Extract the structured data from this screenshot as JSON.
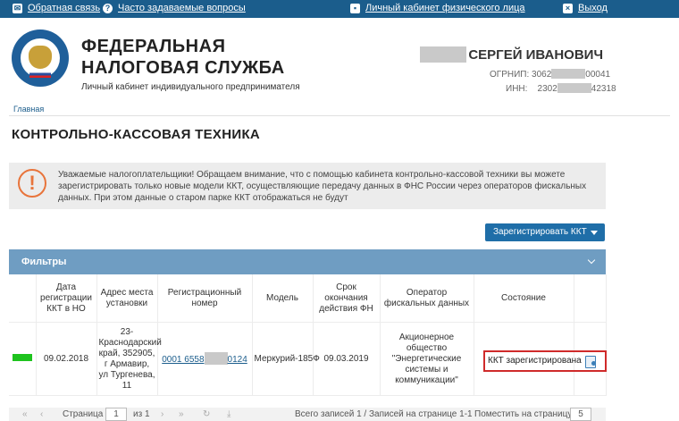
{
  "topbar": {
    "feedback": "Обратная связь",
    "faq": "Часто задаваемые вопросы",
    "personal_account": "Личный кабинет физического лица",
    "exit": "Выход"
  },
  "header": {
    "org_title_line1": "ФЕДЕРАЛЬНАЯ",
    "org_title_line2": "НАЛОГОВАЯ СЛУЖБА",
    "org_subtitle": "Личный кабинет индивидуального предпринимателя",
    "user_name": "СЕРГЕЙ ИВАНОВИЧ",
    "ogrnip_label": "ОГРНИП:",
    "ogrnip_prefix": "3062",
    "ogrnip_suffix": "00041",
    "inn_label": "ИНН:",
    "inn_prefix": "2302",
    "inn_suffix": "42318"
  },
  "breadcrumb": "Главная",
  "page_title": "КОНТРОЛЬНО-КАССОВАЯ ТЕХНИКА",
  "notice": {
    "icon": "exclamation-icon",
    "text": "Уважаемые налогоплательщики! Обращаем внимание, что с помощью кабинета контрольно-кассовой техники вы можете зарегистрировать только новые модели ККТ, осуществляющие передачу данных в ФНС России через операторов фискальных данных. При этом данные о старом парке ККТ отображаться не будут"
  },
  "register_button": "Зарегистрировать ККТ",
  "filters_label": "Фильтры",
  "table": {
    "headers": [
      "Дата регистрации ККТ в НО",
      "Адрес места установки",
      "Регистрационный номер",
      "Модель",
      "Срок окончания действия ФН",
      "Оператор фискальных данных",
      "Состояние"
    ],
    "rows": [
      {
        "date": "09.02.2018",
        "address": "23-Краснодарский край, 352905, г Армавир, ул Тургенева, 11",
        "regnum_prefix": "0001 6558",
        "regnum_suffix": "0124",
        "model": "Меркурий-185Ф",
        "fn_expiry": "09.03.2019",
        "operator": "Акционерное общество \"Энергетические системы и коммуникации\"",
        "state": "ККТ зарегистрирована"
      }
    ]
  },
  "pager": {
    "page_label": "Страница",
    "page_value": "1",
    "of_label": "из 1",
    "summary": "Всего записей 1 / Записей на странице 1-1",
    "per_page_label": "Поместить на страницу:",
    "per_page_value": "5"
  },
  "colors": {
    "topbar": "#1b5d8c",
    "accent_button": "#1f6ea8",
    "filters_bar": "#6f9dc2",
    "status_ok": "#1ec31e",
    "highlight_border": "#cf2a2a",
    "notice_icon": "#e8743b"
  }
}
